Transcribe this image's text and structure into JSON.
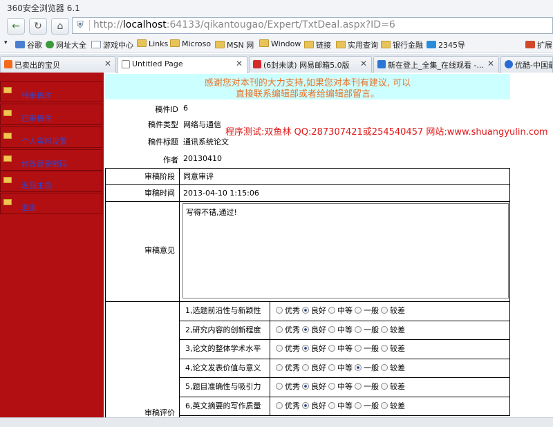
{
  "browser": {
    "title": "360安全浏览器 6.1",
    "url_host": "localhost",
    "url_rest": ":64133/qikantougao/Expert/TxtDeal.aspx?ID=6",
    "favorites": [
      "谷歌",
      "网址大全",
      "游戏中心",
      "Links",
      "Microso",
      "MSN 网",
      "Window",
      "链接",
      "实用查询",
      "银行金融",
      "2345导"
    ],
    "extensions_label": "扩展",
    "tabs": [
      {
        "label": "已卖出的宝贝",
        "active": false
      },
      {
        "label": "Untitled Page",
        "active": true
      },
      {
        "label": "(6封未读) 网易邮箱5.0版",
        "active": false
      },
      {
        "label": "新在登上_全集_在线观看 -...",
        "active": false
      },
      {
        "label": "优酷-中国最",
        "active": false
      }
    ]
  },
  "sidebar": {
    "items": [
      "待审稿件",
      "已审稿件",
      "个人资料设置",
      "修改登录密码",
      "返回主页",
      "退出"
    ]
  },
  "notice": {
    "line1": "感谢您对本刊的大力支持,如果您对本刊有建议, 可以",
    "line2": "直接联系编辑部或者给编辑部留言。"
  },
  "manuscript": {
    "id_label": "稿件ID",
    "id_value": "6",
    "type_label": "稿件类型",
    "type_value": "网络与通信",
    "title_label": "稿件标题",
    "title_value": "通讯系统论文",
    "author_label": "作者",
    "author_value": "20130410"
  },
  "promo": "程序测试:双鱼林 QQ:287307421或254540457 网站:www.shuangyulin.com",
  "review": {
    "stage_label": "审稿阶段",
    "stage_value": "同意审评",
    "time_label": "审稿时间",
    "time_value": "2013-04-10 1:15:06",
    "opinion_label": "审稿意见",
    "opinion_value": "写得不错,通过!",
    "evaluation_label": "审稿评价"
  },
  "evaluation": {
    "options": [
      "优秀",
      "良好",
      "中等",
      "一般",
      "较差"
    ],
    "criteria": [
      {
        "label": "1,选题前沿性与新颖性",
        "selected": "良好"
      },
      {
        "label": "2,研究内容的创新程度",
        "selected": "良好"
      },
      {
        "label": "3,论文的整体学术水平",
        "selected": "良好"
      },
      {
        "label": "4,论文发表价值与意义",
        "selected": "一般"
      },
      {
        "label": "5,题目准确性与吸引力",
        "selected": "良好"
      },
      {
        "label": "6,英文摘要的写作质量",
        "selected": "良好"
      }
    ]
  },
  "colors": {
    "sidebar_bg": "#b20f12",
    "sidebar_text": "#3344cc",
    "notice_bg": "#ccffff",
    "notice_text": "#e8722a",
    "promo_text": "#e01818"
  }
}
